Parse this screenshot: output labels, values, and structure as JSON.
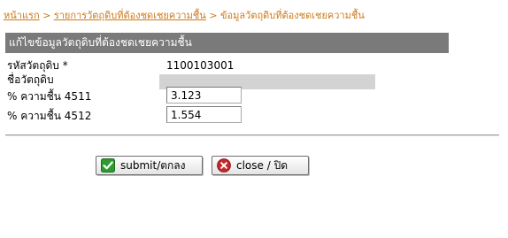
{
  "breadcrumb": {
    "home": "หน้าแรก",
    "separator": ">",
    "list": "รายการวัตถุดิบที่ต้องชดเชยความชื้น",
    "current": "ข้อมูลวัตถุดิบที่ต้องชดเชยความชื้น"
  },
  "section": {
    "title": "แก้ไขข้อมูลวัตถุดิบที่ต้องชดเชยความชื้น"
  },
  "form": {
    "material_code_label": "รหัสวัตถุดิบ *",
    "material_code_value": "1100103001",
    "material_name_label": "ชื่อวัตถุดิบ",
    "moisture_4511_label": "% ความชื้น 4511",
    "moisture_4511_value": "3.123",
    "moisture_4512_label": "% ความชื้น 4512",
    "moisture_4512_value": "1.554"
  },
  "buttons": {
    "submit_label": "submit/ตกลง",
    "close_label": "close / ปิด"
  },
  "colors": {
    "link": "#cc7a1a",
    "header_bg": "#7a7a7a",
    "check_green": "#2e9b2e",
    "close_red": "#c62828"
  },
  "icons": {
    "submit": "check-icon",
    "close": "close-circle-icon"
  }
}
